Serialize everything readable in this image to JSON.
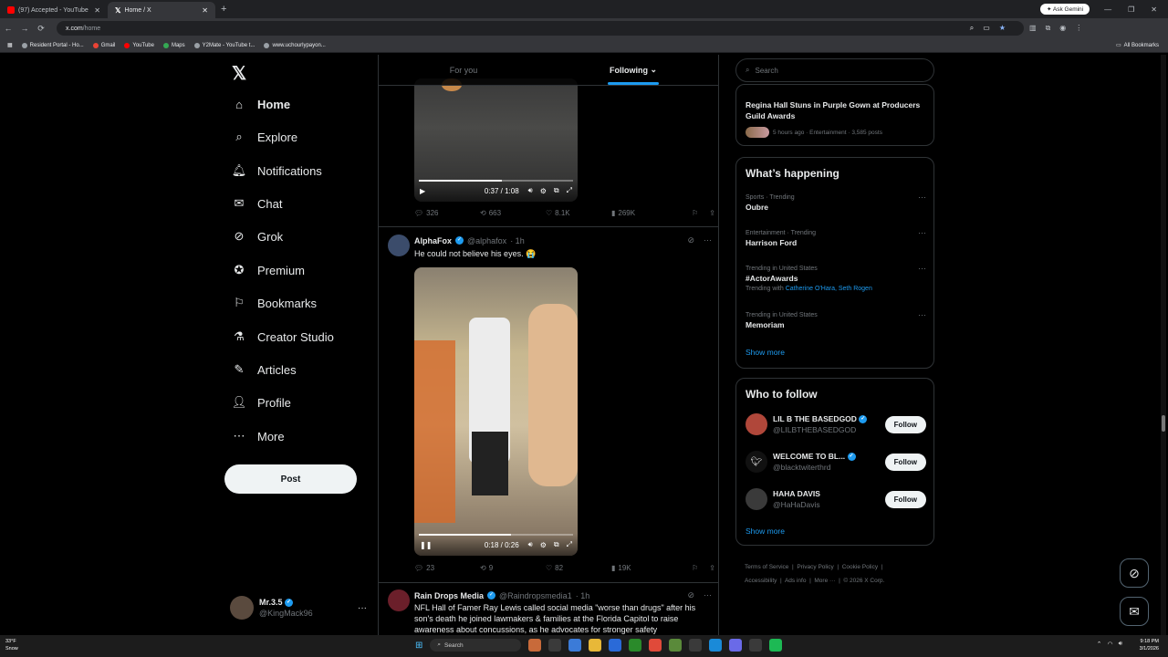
{
  "browser": {
    "tabs": [
      {
        "title": "(97) Accepted - YouTube",
        "active": false
      },
      {
        "title": "Home / X",
        "active": true
      }
    ],
    "ask_gemini": "Ask Gemini",
    "url_host": "x.com",
    "url_path": "/home",
    "bookmarks": [
      "Resident Portal - Ho...",
      "Gmail",
      "YouTube",
      "Maps",
      "Y2Mate - YouTube t...",
      "www.uchourlypayon..."
    ],
    "all_bookmarks": "All Bookmarks"
  },
  "nav": {
    "items": [
      {
        "label": "Home",
        "icon": "home-icon"
      },
      {
        "label": "Explore",
        "icon": "search-icon"
      },
      {
        "label": "Notifications",
        "icon": "bell-icon"
      },
      {
        "label": "Chat",
        "icon": "mail-icon"
      },
      {
        "label": "Grok",
        "icon": "grok-icon"
      },
      {
        "label": "Premium",
        "icon": "premium-icon"
      },
      {
        "label": "Bookmarks",
        "icon": "bookmark-icon"
      },
      {
        "label": "Creator Studio",
        "icon": "creator-studio-icon"
      },
      {
        "label": "Articles",
        "icon": "articles-icon"
      },
      {
        "label": "Profile",
        "icon": "profile-icon"
      },
      {
        "label": "More",
        "icon": "more-icon"
      }
    ],
    "post_label": "Post",
    "account": {
      "name": "Mr.3.5",
      "handle": "@KingMack96"
    }
  },
  "feed": {
    "tabs": [
      "For you",
      "Following"
    ],
    "video1": {
      "time": "0:37 / 1:08",
      "progress": 0.54
    },
    "post1_actions": {
      "replies": "326",
      "reposts": "663",
      "likes": "8.1K",
      "views": "269K"
    },
    "post2": {
      "name": "AlphaFox",
      "handle": "@alphafox",
      "age": "· 1h",
      "text": "He could not believe his eyes. 😭",
      "video_time": "0:18 / 0:26",
      "progress": 0.6,
      "replies": "23",
      "reposts": "9",
      "likes": "82",
      "views": "19K"
    },
    "post3": {
      "name": "Rain Drops Media",
      "handle": "@Raindropsmedia1",
      "age": "· 1h",
      "text": "NFL Hall of Famer Ray Lewis called social media \"worse than drugs\" after his son's death he joined lawmakers & families at the Florida Capitol to raise awareness about concussions, as he advocates for stronger safety"
    }
  },
  "sidebar": {
    "search_placeholder": "Search",
    "news": {
      "title": "Regina Hall Stuns in Purple Gown at Producers Guild Awards",
      "meta": "5 hours ago · Entertainment · 3,585 posts"
    },
    "happening_title": "What’s happening",
    "trends": [
      {
        "context": "Sports · Trending",
        "topic": "Oubre",
        "extra": ""
      },
      {
        "context": "Entertainment · Trending",
        "topic": "Harrison Ford",
        "extra": ""
      },
      {
        "context": "Trending in United States",
        "topic": "#ActorAwards",
        "extra": "Catherine O'Hara, Seth Rogen"
      },
      {
        "context": "Trending in United States",
        "topic": "Memoriam",
        "extra": ""
      }
    ],
    "trending_with": "Trending with",
    "show_more": "Show more",
    "who_to_follow_title": "Who to follow",
    "who_to_follow": [
      {
        "name": "LIL B THE BASEDGOD",
        "handle": "@LILBTHEBASEDGOD",
        "color": "#b0473a"
      },
      {
        "name": "WELCOME TO BL...",
        "handle": "@blacktwiterthrd",
        "color": "#111111"
      },
      {
        "name": "HAHA DAVIS",
        "handle": "@HaHaDavis",
        "color": "#3a3a3a"
      }
    ],
    "follow_label": "Follow",
    "footer_line1": [
      "Terms of Service",
      "Privacy Policy",
      "Cookie Policy"
    ],
    "footer_line2": [
      "Accessibility",
      "Ads info",
      "More ···",
      "© 2026 X Corp."
    ]
  },
  "taskbar": {
    "temp": "33°F",
    "cond": "Snow",
    "search": "Search",
    "time": "9:18 PM",
    "date": "3/1/2026"
  }
}
